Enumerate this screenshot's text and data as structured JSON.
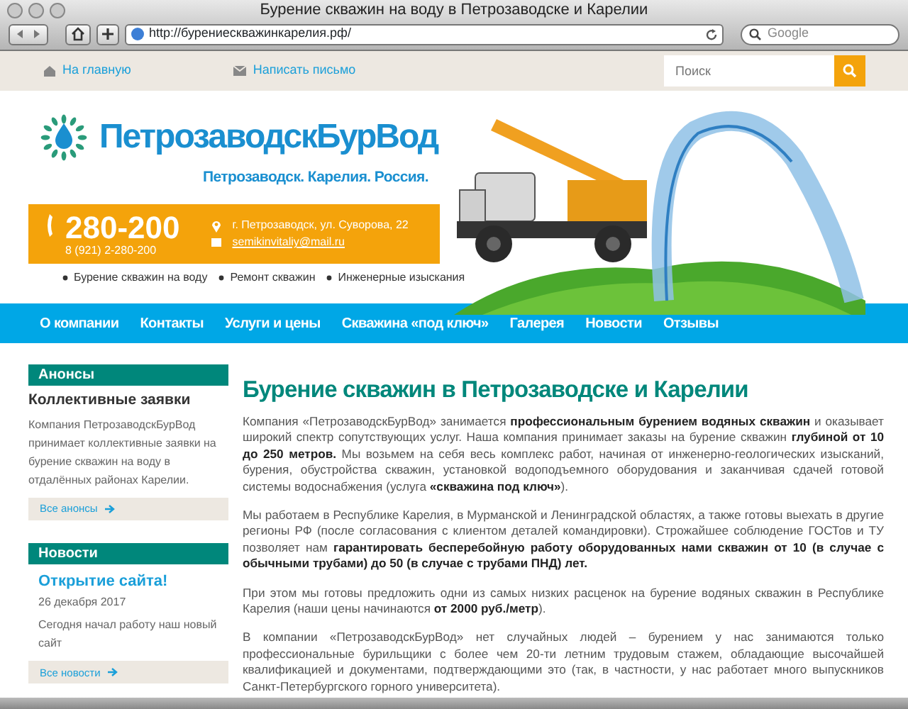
{
  "window": {
    "title": "Бурение скважин на воду в Петрозаводске и Карелии",
    "url": "http://бурениескважинкарелия.рф/",
    "search_placeholder": "Google"
  },
  "topbar": {
    "links": [
      {
        "kind": "home",
        "label": "На главную"
      },
      {
        "kind": "mail",
        "label": "Написать письмо"
      }
    ],
    "search_placeholder": "Поиск"
  },
  "header": {
    "brand": "ПетрозаводскБурВод",
    "tagline": "Петрозаводск. Карелия. Россия.",
    "phone": "280-200",
    "phone_alt": "8 (921) 2-280-200",
    "address": "г. Петрозаводск, ул. Суворова, 22",
    "email": "semikinvitaliy@mail.ru",
    "services": [
      "Бурение скважин на воду",
      "Ремонт скважин",
      "Инженерные изыскания"
    ]
  },
  "nav": {
    "items": [
      "О компании",
      "Контакты",
      "Услуги и цены",
      "Скважина «под ключ»",
      "Галерея",
      "Новости",
      "Отзывы"
    ]
  },
  "sidebar": {
    "blocks": [
      {
        "kind": "announce",
        "heading": "Анонсы",
        "title": "Коллективные заявки",
        "text": "Компания ПетрозаводскБурВод принимает коллективные заявки на бурение скважин на воду в отдалённых районах Карелии.",
        "more": "Все анонсы"
      },
      {
        "kind": "news",
        "heading": "Новости",
        "title": "Открытие сайта!",
        "date": "26 декабря 2017",
        "text": "Сегодня начал работу наш новый сайт",
        "more": "Все новости"
      }
    ]
  },
  "article": {
    "heading": "Бурение скважин в Петрозаводске и Карелии",
    "paragraphs": [
      "Компания «ПетрозаводскБурВод» занимается **профессиональным бурением водяных скважин** и оказывает широкий спектр сопутствующих услуг. Наша компания принимает заказы на бурение скважин **глубиной от 10 до 250 метров.** Мы возьмем на себя весь комплекс работ, начиная от инженерно-геологических изысканий, бурения, обустройства скважин, установкой водоподъемного оборудования и заканчивая сдачей готовой системы водоснабжения (услуга **«скважина под ключ»**).",
      "Мы работаем в Республике Карелия, в Мурманской и Ленинградской областях, а также готовы выехать в другие регионы РФ (после согласования с клиентом деталей командировки). Строжайшее соблюдение ГОСТов и ТУ позволяет нам **гарантировать бесперебойную работу оборудованных нами скважин от 10 (в случае с обычными трубами) до 50 (в случае с трубами ПНД) лет.**",
      "При этом мы готовы предложить одни из самых низких расценок на бурение водяных скважин в Республике Карелия (наши цены начинаются **от 2000 руб./метр**).",
      "В компании «ПетрозаводскБурВод» нет случайных людей – бурением у нас занимаются только профессиональные бурильщики с более чем 20-ти летним трудовым стажем, обладающие высочайшей квалификацией и документами, подтверждающими это (так, в частности, у нас работает много выпускников Санкт-Петербургского горного университета)."
    ]
  }
}
